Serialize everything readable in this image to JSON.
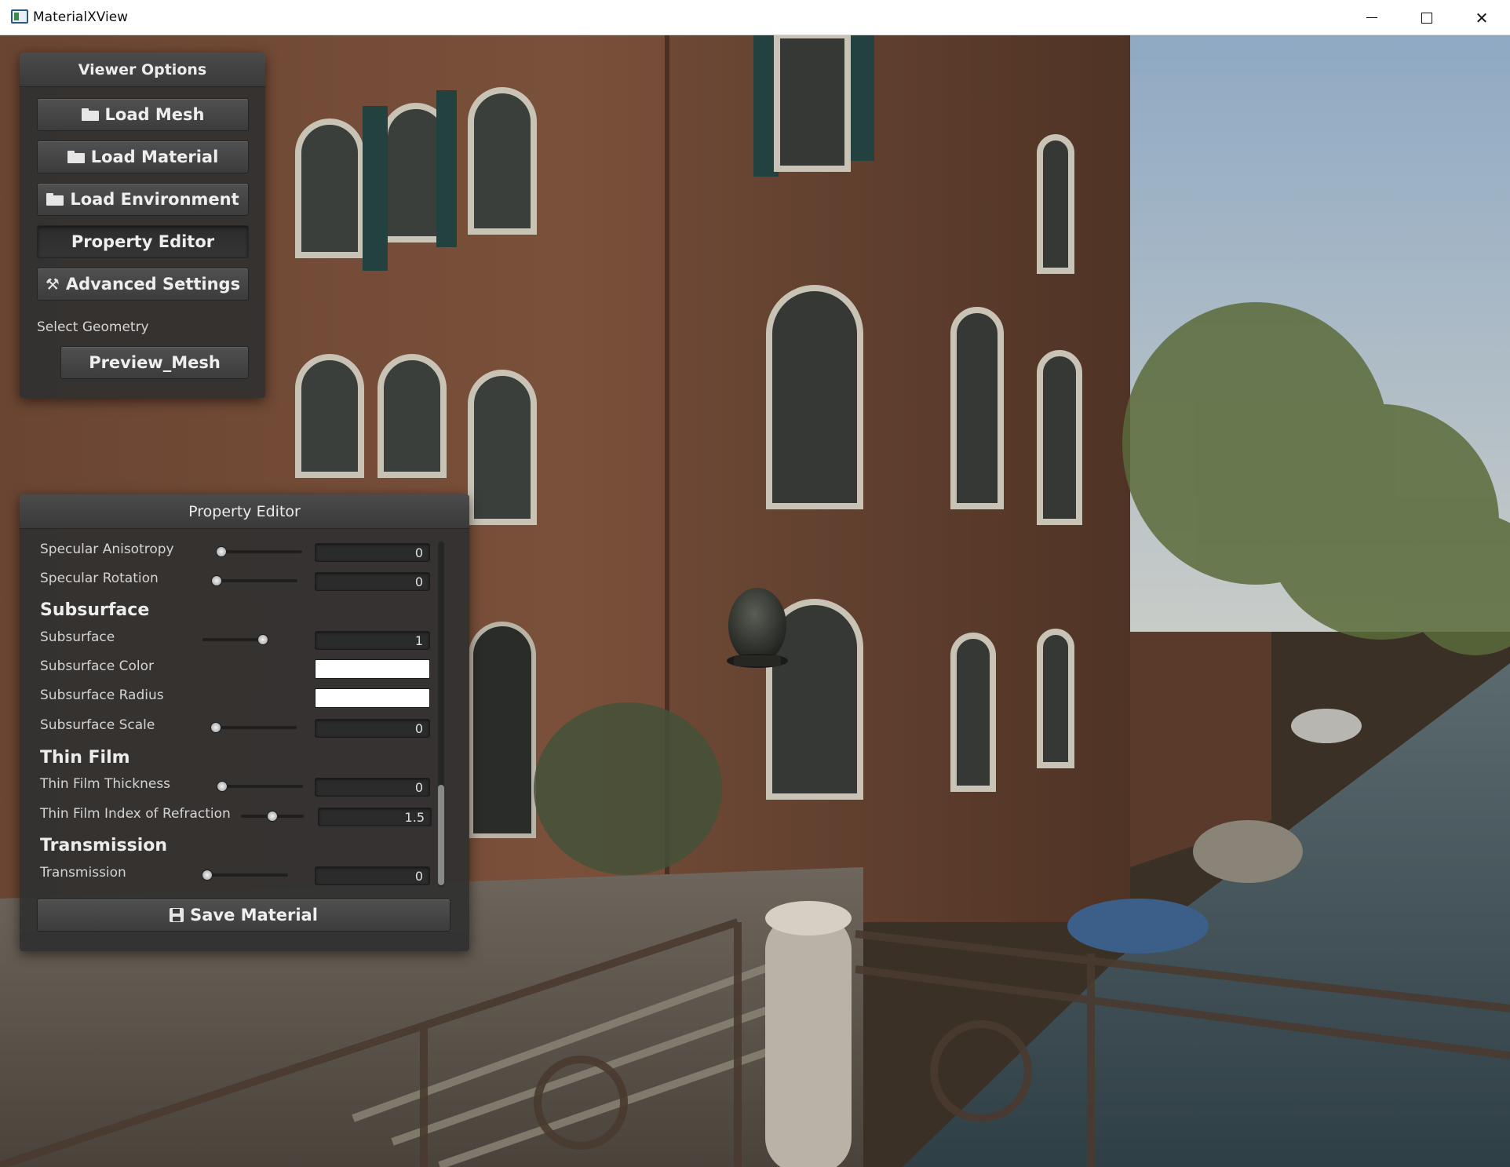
{
  "window": {
    "title": "MaterialXView"
  },
  "viewer_options": {
    "title": "Viewer Options",
    "load_mesh": "Load Mesh",
    "load_material": "Load Material",
    "load_environment": "Load Environment",
    "property_editor": "Property Editor",
    "advanced_settings": "Advanced Settings",
    "select_geometry_label": "Select Geometry",
    "geometry_value": "Preview_Mesh"
  },
  "property_editor": {
    "title": "Property Editor",
    "rows": [
      {
        "label": "Specular Anisotropy",
        "value": "0",
        "slider": 0.0
      },
      {
        "label": "Specular Rotation",
        "value": "0",
        "slider": 0.0
      },
      {
        "section": "Subsurface"
      },
      {
        "label": "Subsurface",
        "value": "1",
        "slider": 1.0
      },
      {
        "label": "Subsurface Color",
        "color": "#ffffff"
      },
      {
        "label": "Subsurface Radius",
        "color": "#ffffff"
      },
      {
        "label": "Subsurface Scale",
        "value": "0",
        "slider": 0.0
      },
      {
        "section": "Thin Film"
      },
      {
        "label": "Thin Film Thickness",
        "value": "0",
        "slider": 0.0
      },
      {
        "label": "Thin Film Index of Refraction",
        "value": "1.5",
        "slider": 0.5
      },
      {
        "section": "Transmission"
      },
      {
        "label": "Transmission",
        "value": "0",
        "slider": 0.0
      }
    ],
    "save_material": "Save Material"
  },
  "icons": {
    "folder": "folder-icon",
    "tools": "tools-icon",
    "save": "save-icon"
  }
}
